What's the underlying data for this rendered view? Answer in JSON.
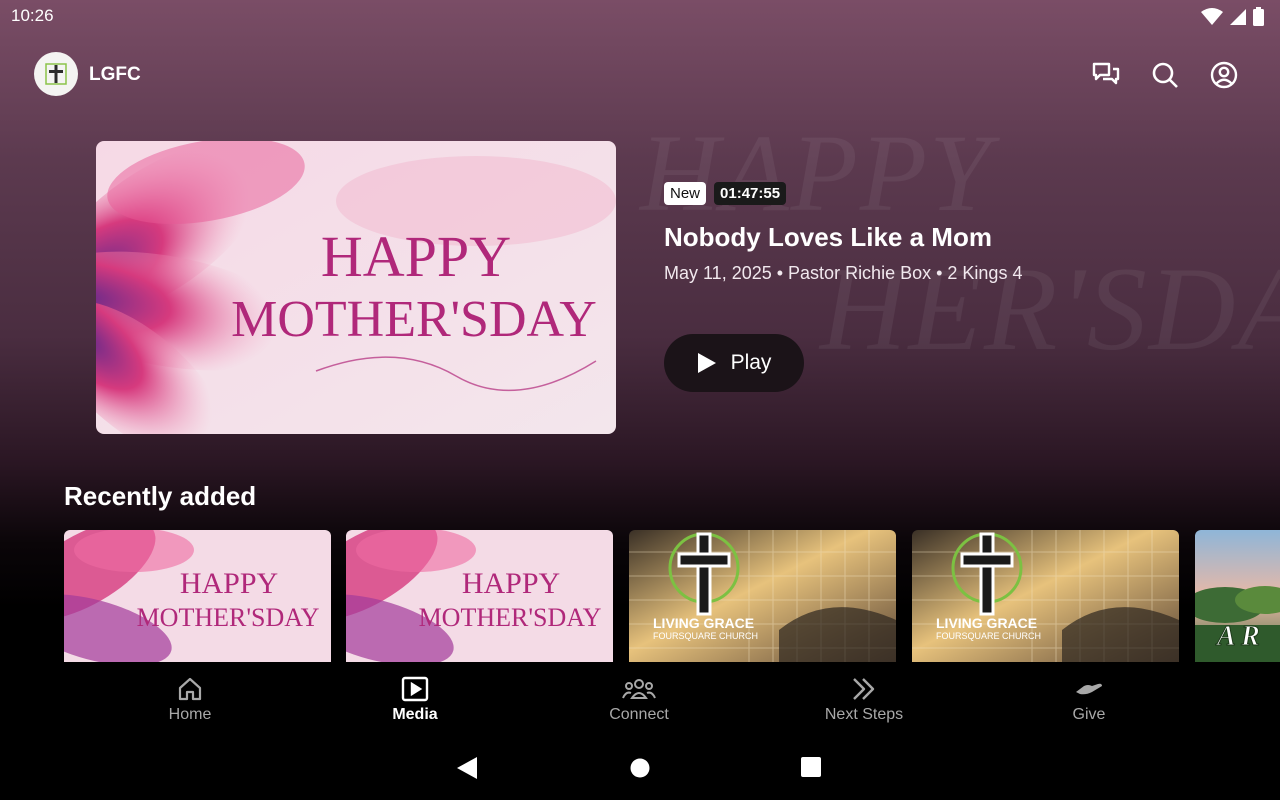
{
  "status_bar": {
    "time": "10:26"
  },
  "app": {
    "name": "LGFC"
  },
  "featured": {
    "badge_new": "New",
    "duration": "01:47:55",
    "title": "Nobody Loves Like a Mom",
    "meta": "May 11, 2025 • Pastor Richie Box • 2 Kings 4",
    "play_label": "Play",
    "artwork_text": {
      "line1": "HAPPY",
      "line2": "MOTHER'SDAY"
    }
  },
  "background_text": {
    "line1": "HAPPY",
    "line2": "HER'SDAY"
  },
  "recently_added": {
    "title": "Recently added",
    "items": [
      {
        "line1": "HAPPY",
        "line2": "MOTHER'SDAY"
      },
      {
        "line1": "HAPPY",
        "line2": "MOTHER'SDAY"
      },
      {
        "line1": "LIVING GRACE",
        "line2": "FOURSQUARE CHURCH"
      },
      {
        "line1": "LIVING GRACE",
        "line2": "FOURSQUARE CHURCH"
      },
      {
        "line1": "A R"
      }
    ]
  },
  "bottom_nav": [
    {
      "label": "Home",
      "icon": "home-icon",
      "active": false
    },
    {
      "label": "Media",
      "icon": "media-play-icon",
      "active": true
    },
    {
      "label": "Connect",
      "icon": "people-group-icon",
      "active": false
    },
    {
      "label": "Next Steps",
      "icon": "double-chevron-right-icon",
      "active": false
    },
    {
      "label": "Give",
      "icon": "giving-hand-icon",
      "active": false
    }
  ],
  "colors": {
    "accent": "#b0287a",
    "background_top": "#7a4d66",
    "background_bottom": "#000000"
  }
}
